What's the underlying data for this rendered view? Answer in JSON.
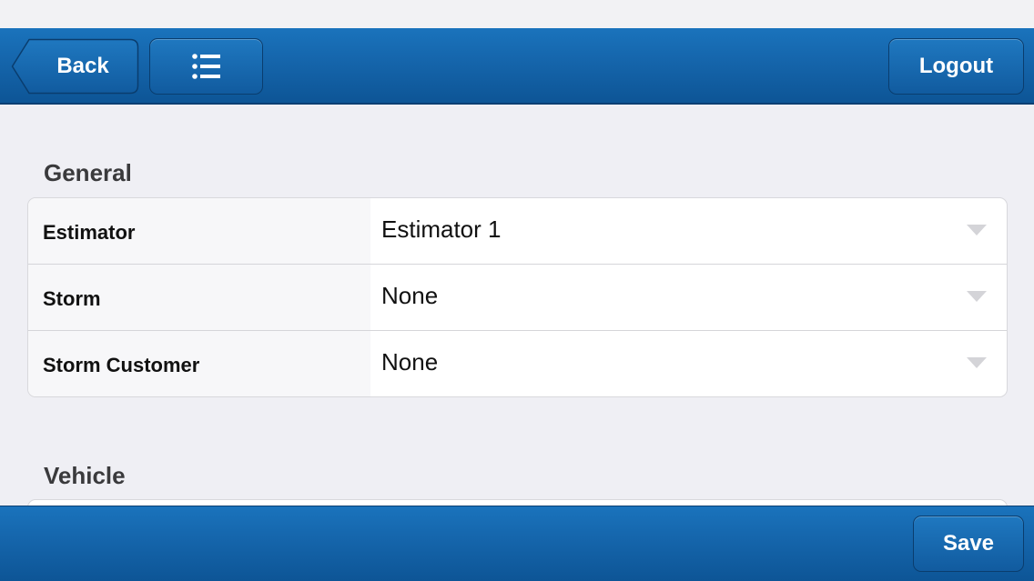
{
  "header": {
    "back_label": "Back",
    "menu_icon": "list-icon",
    "logout_label": "Logout"
  },
  "sections": {
    "general": {
      "title": "General",
      "rows": [
        {
          "label": "Estimator",
          "value": "Estimator 1"
        },
        {
          "label": "Storm",
          "value": "None"
        },
        {
          "label": "Storm Customer",
          "value": "None"
        }
      ]
    },
    "vehicle": {
      "title": "Vehicle"
    }
  },
  "footer": {
    "save_label": "Save"
  },
  "colors": {
    "bar_blue": "#1565ab",
    "background": "#efeff4",
    "caret": "#d4d4d8"
  }
}
